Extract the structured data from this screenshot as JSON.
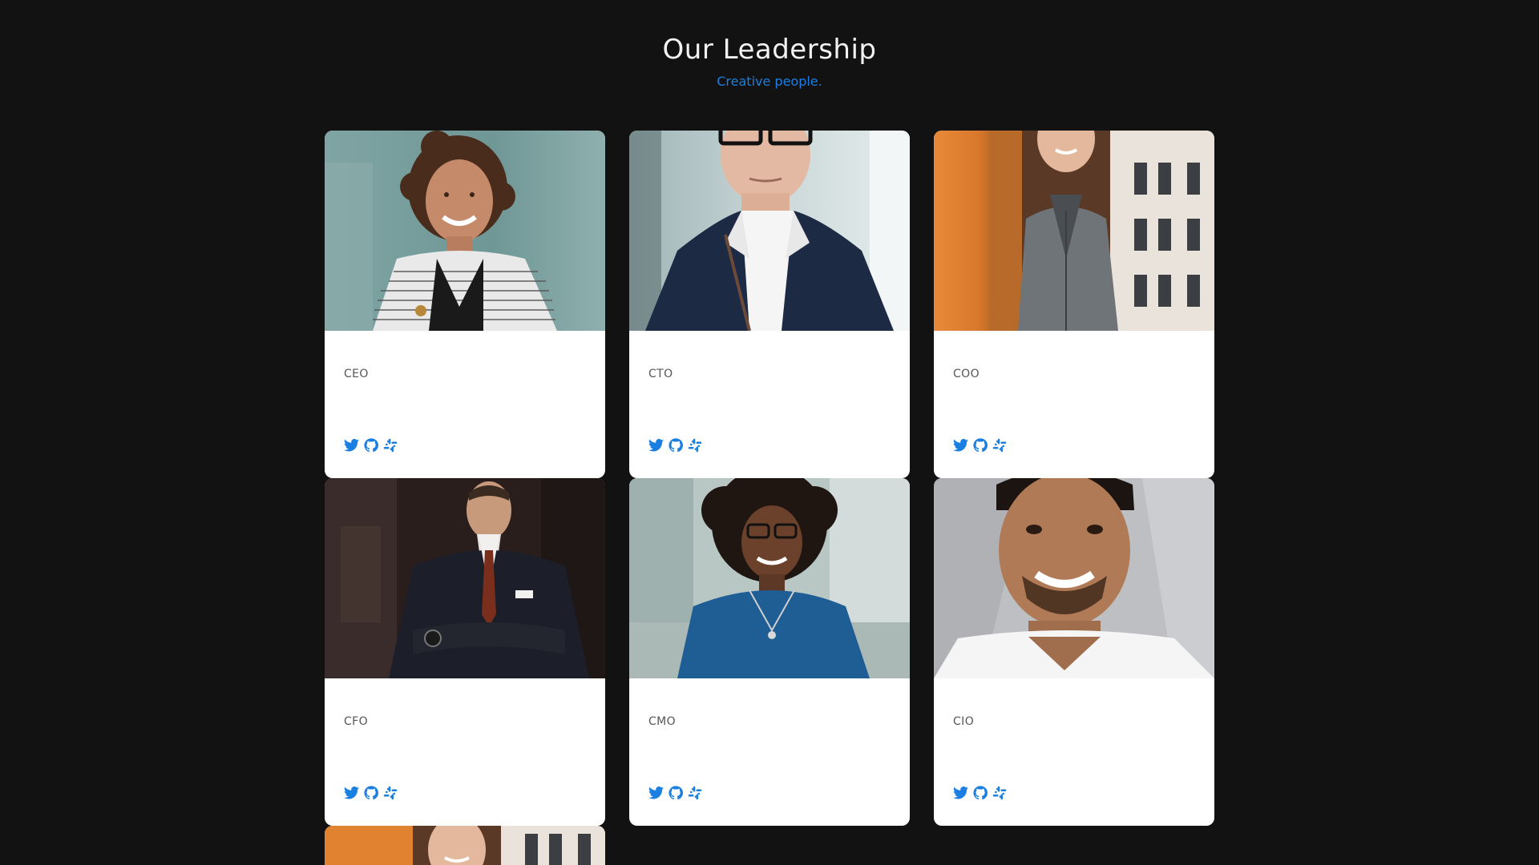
{
  "header": {
    "title": "Our Leadership",
    "subtitle": "Creative people."
  },
  "colors": {
    "background": "#121212",
    "accent": "#1a7fe0",
    "card": "#ffffff"
  },
  "team": [
    {
      "role": "CEO",
      "photo": "woman-curly-hair-striped-cardigan",
      "icons": [
        "twitter-icon",
        "github-icon",
        "slack-icon"
      ]
    },
    {
      "role": "CTO",
      "photo": "man-glasses-navy-blazer",
      "icons": [
        "twitter-icon",
        "github-icon",
        "slack-icon"
      ]
    },
    {
      "role": "COO",
      "photo": "woman-long-hair-gray-blazer-orange-wall",
      "icons": [
        "twitter-icon",
        "github-icon",
        "slack-icon"
      ]
    },
    {
      "role": "CFO",
      "photo": "man-dark-suit-arms-crossed",
      "icons": [
        "twitter-icon",
        "github-icon",
        "slack-icon"
      ]
    },
    {
      "role": "CMO",
      "photo": "woman-curly-hair-blue-top",
      "icons": [
        "twitter-icon",
        "github-icon",
        "slack-icon"
      ]
    },
    {
      "role": "CIO",
      "photo": "man-white-tshirt-smiling",
      "icons": [
        "twitter-icon",
        "github-icon",
        "slack-icon"
      ]
    }
  ]
}
